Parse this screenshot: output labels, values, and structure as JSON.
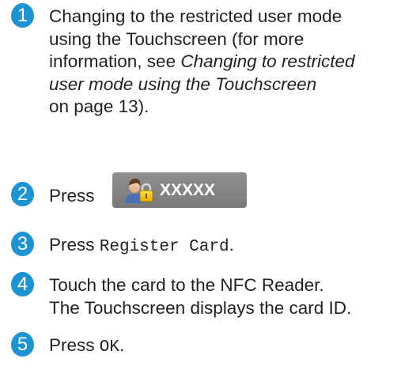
{
  "steps": [
    {
      "number": "1",
      "line1": "Changing to the restricted user mode",
      "line2": "using the Touchscreen (for more",
      "line3": "information, see ",
      "line3_italic": "Changing to restricted",
      "line4_italic": "user mode using the Touchscreen",
      "line5": "on page 13)."
    },
    {
      "number": "2",
      "text": "Press",
      "button_label": "XXXXX",
      "button_icon": "user-lock-icon"
    },
    {
      "number": "3",
      "prefix": "Press ",
      "code": "Register Card",
      "suffix": "."
    },
    {
      "number": "4",
      "line1": "Touch the card to the NFC Reader.",
      "line2": "The Touchscreen displays the card ID."
    },
    {
      "number": "5",
      "prefix": "Press ",
      "code": "OK",
      "suffix": "."
    }
  ],
  "colors": {
    "step_badge": "#1d93d2",
    "button_bg": "#858585"
  }
}
